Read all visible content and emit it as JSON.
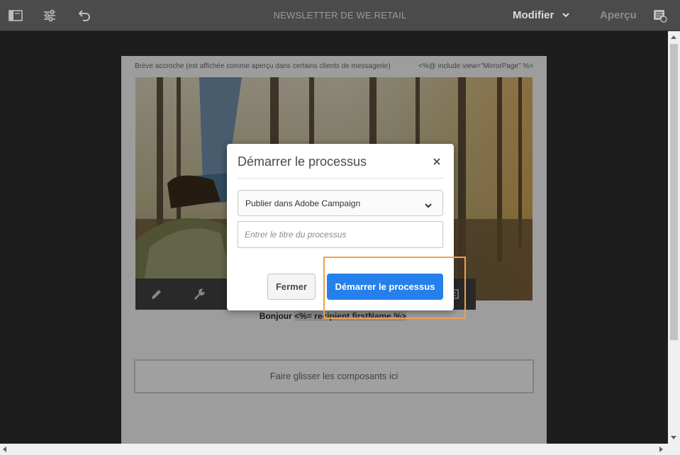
{
  "toolbar": {
    "title": "NEWSLETTER DE WE.RETAIL",
    "modify_label": "Modifier",
    "preview_label": "Aperçu",
    "icons": [
      "sidebar-toggle-icon",
      "properties-sliders-icon",
      "undo-icon",
      "chevron-down-icon",
      "page-info-icon"
    ]
  },
  "page": {
    "preheader": "Brève accroche (est affichée comme aperçu dans certains clients de messagerie)",
    "include_tag": "<%@ include view=\"MirrorPage\" %>",
    "greeting_prefix": "Bonjour ",
    "greeting_token": "<%= recipient.firstName %>",
    "greeting_suffix": ".",
    "dropzone_label": "Faire glisser les composants ici"
  },
  "component_toolbar": {
    "icons": [
      "edit-pencil-icon",
      "configure-wrench-icon",
      "more-options-icon"
    ]
  },
  "dialog": {
    "title": "Démarrer le processus",
    "workflow_selected": "Publier dans Adobe Campaign",
    "title_placeholder": "Entrer le titre du processus",
    "close_label": "Fermer",
    "start_label": "Démarrer le processus"
  },
  "colors": {
    "accent": "#2680eb",
    "highlight": "#f0a050",
    "toolbar_bg": "#4b4b4b"
  }
}
